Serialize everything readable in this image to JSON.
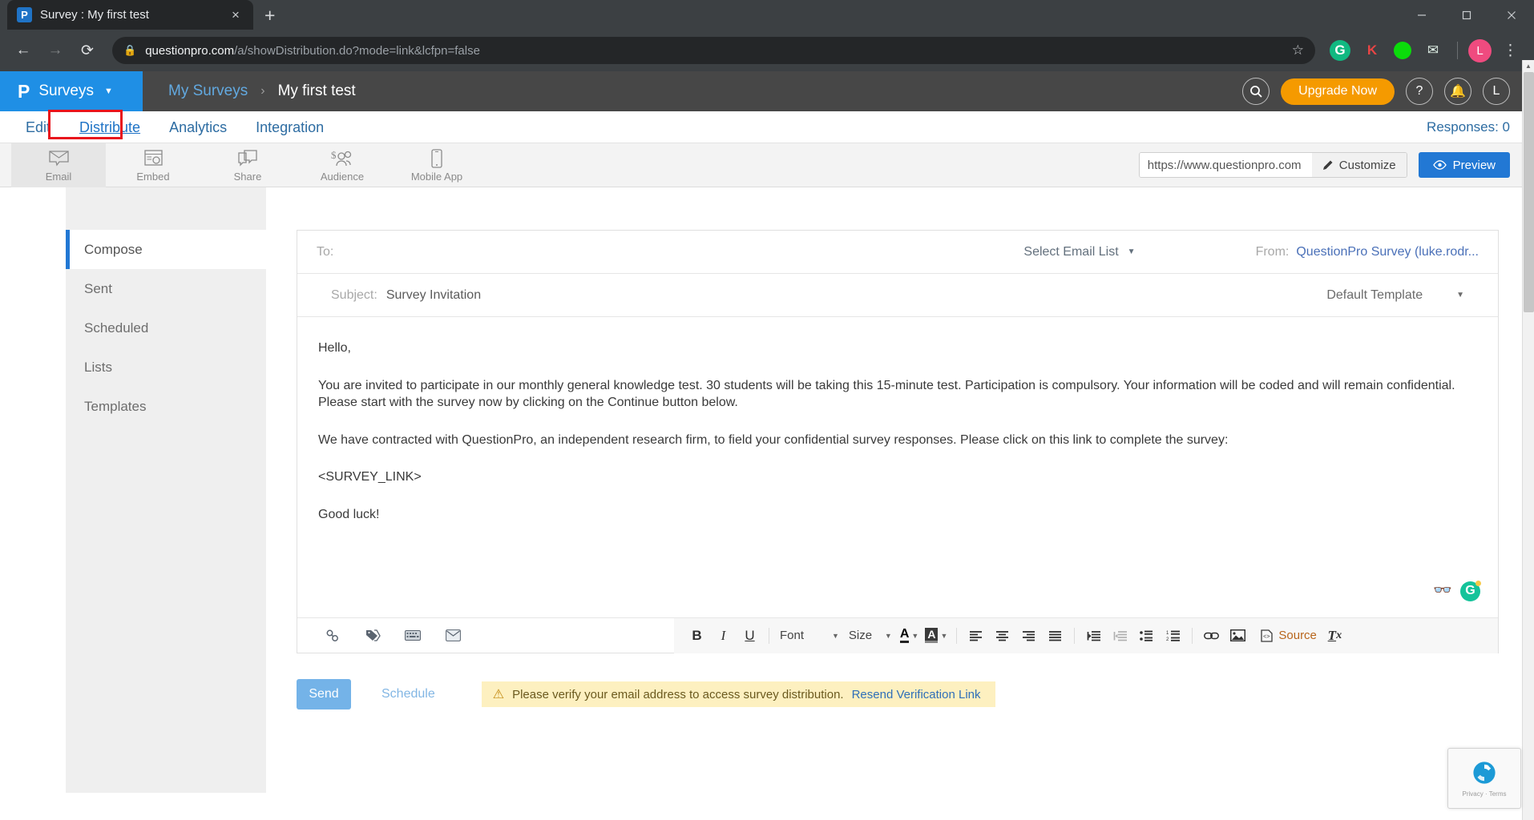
{
  "browser": {
    "tab": {
      "title": "Survey : My first test",
      "favicon_letter": "P",
      "close_label": "×",
      "new_tab_label": "+"
    },
    "address": {
      "domain": "questionpro.com",
      "path": "/a/showDistribution.do?mode=link&lcfpn=false",
      "lock_icon": "lock-icon",
      "star_icon": "bookmark-star-icon"
    },
    "extensions": [
      {
        "name": "grammarly-extension",
        "glyph": "G"
      },
      {
        "name": "kaspersky-extension",
        "glyph": "K"
      },
      {
        "name": "green-square-extension",
        "glyph": ""
      },
      {
        "name": "mail-extension",
        "glyph": "✉"
      }
    ],
    "profile_letter": "L",
    "menu_icon": "kebab-menu-icon",
    "window": {
      "minimize": "—",
      "restore": "❐",
      "close": "✕"
    }
  },
  "app_header": {
    "brand_logo": "P",
    "brand_text": "Surveys",
    "brand_caret": "▼",
    "breadcrumb": {
      "parent": "My Surveys",
      "separator": "›",
      "current": "My first test"
    },
    "search_icon": "search-icon",
    "upgrade_label": "Upgrade Now",
    "help_icon": "question-mark-icon",
    "notification_icon": "bell-icon",
    "avatar_letter": "L"
  },
  "tabs": {
    "items": [
      {
        "label": "Edit",
        "active": false
      },
      {
        "label": "Distribute",
        "active": true
      },
      {
        "label": "Analytics",
        "active": false
      },
      {
        "label": "Integration",
        "active": false
      }
    ],
    "responses_label": "Responses: 0",
    "highlight_color": "#e8141c"
  },
  "channels": {
    "items": [
      {
        "label": "Email",
        "icon": "envelope-icon",
        "active": true
      },
      {
        "label": "Embed",
        "icon": "embed-code-icon",
        "active": false
      },
      {
        "label": "Share",
        "icon": "share-speech-bubble-icon",
        "active": false
      },
      {
        "label": "Audience",
        "icon": "audience-people-icon",
        "active": false
      },
      {
        "label": "Mobile App",
        "icon": "mobile-phone-icon",
        "active": false
      }
    ],
    "survey_url": "https://www.questionpro.com",
    "customize_label": "Customize",
    "customize_icon": "pencil-icon",
    "preview_label": "Preview",
    "preview_icon": "eye-icon"
  },
  "side_menu": {
    "items": [
      {
        "label": "Compose",
        "active": true
      },
      {
        "label": "Sent",
        "active": false
      },
      {
        "label": "Scheduled",
        "active": false
      },
      {
        "label": "Lists",
        "active": false
      },
      {
        "label": "Templates",
        "active": false
      }
    ]
  },
  "compose": {
    "to_label": "To:",
    "to_value": "",
    "email_list_label": "Select Email List",
    "from_label": "From:",
    "from_value": "QuestionPro Survey (luke.rodr...",
    "subject_label": "Subject:",
    "subject_value": "Survey Invitation",
    "template_label": "Default Template",
    "caret": "▼",
    "body": {
      "greeting": "Hello,",
      "paragraph1": "You are invited to participate in our monthly general knowledge test. 30 students will be taking this 15-minute test. Participation is compulsory. Your information will be coded and will remain confidential. Please start with the survey now by clicking on the Continue button below.",
      "paragraph2": "We have contracted with QuestionPro, an independent research firm, to field your confidential survey responses. Please click on this link to complete the survey:",
      "survey_link_token": "<SURVEY_LINK>",
      "closing": "Good luck!"
    },
    "grammarly": {
      "glasses_icon": "glasses-icon",
      "badge_letter": "G"
    }
  },
  "editor_toolbar": {
    "left_icons": [
      {
        "name": "insert-link-chain-icon",
        "glyph": "🔗"
      },
      {
        "name": "merge-tag-icon",
        "glyph": "🏷"
      },
      {
        "name": "keyboard-icon",
        "glyph": "⌨"
      },
      {
        "name": "email-template-icon",
        "glyph": "✉"
      }
    ],
    "bold_label": "B",
    "italic_label": "I",
    "underline_label": "U",
    "font_label": "Font",
    "size_label": "Size",
    "text_color_label": "A",
    "bg_color_label": "A",
    "align_icons": [
      {
        "name": "align-left-icon"
      },
      {
        "name": "align-center-icon"
      },
      {
        "name": "align-right-icon"
      },
      {
        "name": "align-justify-icon"
      },
      {
        "name": "increase-indent-icon"
      },
      {
        "name": "decrease-indent-icon"
      },
      {
        "name": "bulleted-list-icon"
      },
      {
        "name": "numbered-list-icon"
      }
    ],
    "link_icon": "link-icon",
    "image_icon": "image-icon",
    "source_label": "Source",
    "source_icon": "source-code-icon",
    "remove_format_label": "Tx",
    "remove_format_icon": "remove-format-icon"
  },
  "actions": {
    "send_label": "Send",
    "schedule_label": "Schedule",
    "warning_icon": "warning-triangle-icon",
    "warning_text": "Please verify your email address to access survey distribution.",
    "resend_link_label": "Resend Verification Link"
  },
  "recaptcha": {
    "text": "Privacy · Terms",
    "icon": "recaptcha-icon"
  }
}
